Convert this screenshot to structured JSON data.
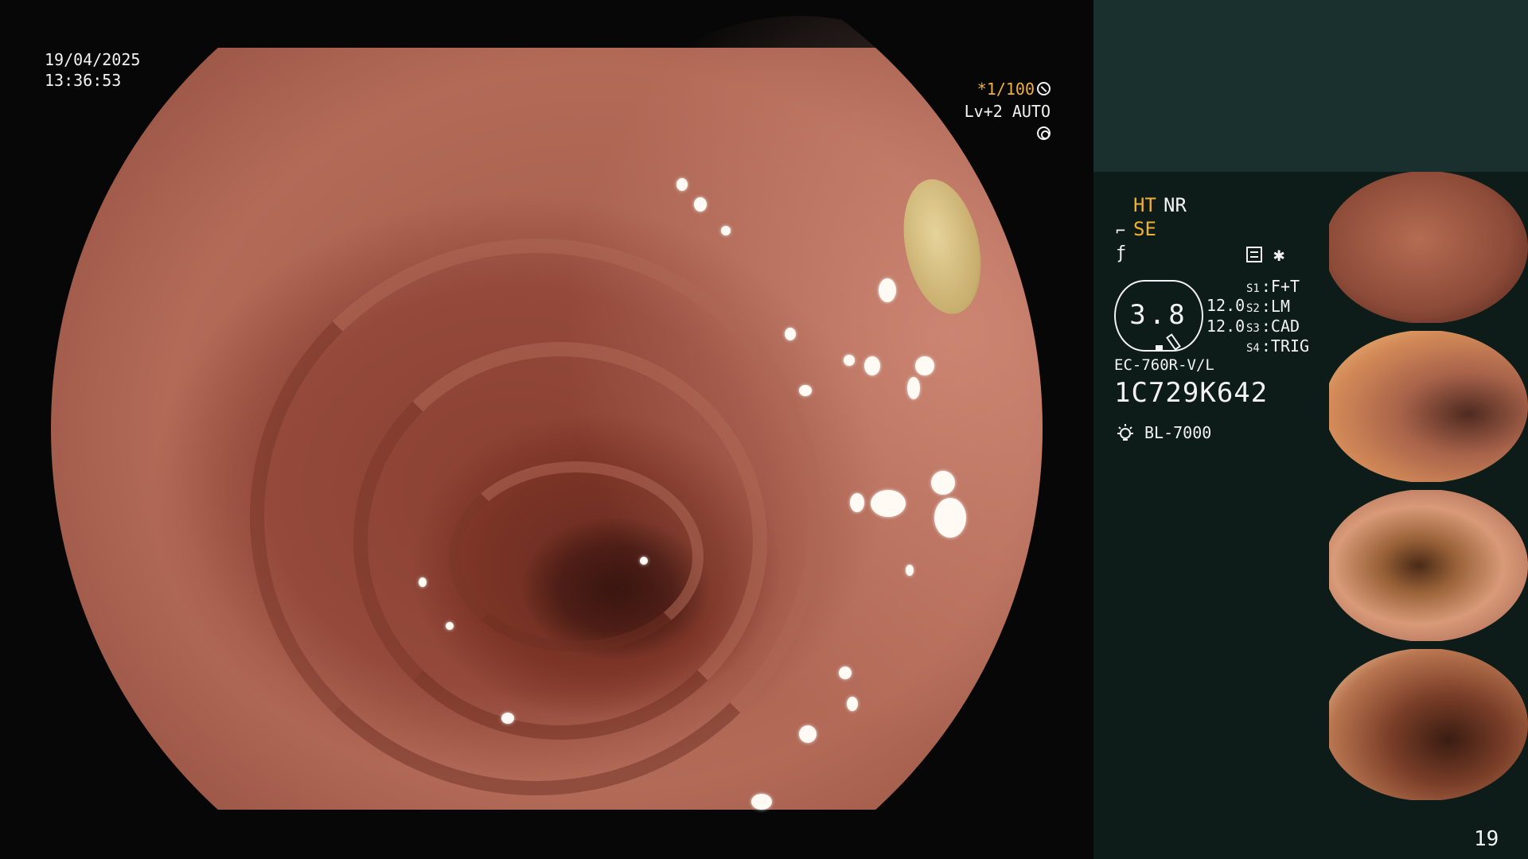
{
  "overlay": {
    "date": "19/04/2025",
    "time": "13:36:53",
    "shutter": "*1/100",
    "level": "Lv+2 AUTO"
  },
  "panel": {
    "modes": {
      "ht": "HT",
      "nr": "NR",
      "se": "SE"
    },
    "zoom_value": "3.8",
    "gauge_a": "12.0",
    "gauge_b": "12.0",
    "switches": [
      {
        "key": "S1",
        "label": "F+T"
      },
      {
        "key": "S2",
        "label": "LM"
      },
      {
        "key": "S3",
        "label": "CAD"
      },
      {
        "key": "S4",
        "label": "TRIG"
      }
    ],
    "scope_model": "EC-760R-V/L",
    "scope_serial": "1C729K642",
    "light_source": "BL-7000",
    "page_number": "19"
  },
  "icons": {
    "shutter_icon": "circle-shutter-icon",
    "level_icon": "circle-gear-icon",
    "se_icon": "structure-enhance-icon",
    "f_icon": "color-f-icon",
    "settings_icon": "settings-list-icon",
    "asterisk_icon": "asterisk-icon",
    "light_icon": "light-bulb-icon"
  },
  "colors": {
    "accent_orange": "#f0b030",
    "panel_top": "#1a302e",
    "panel_bg": "#0d1b19",
    "text": "#f2f2f2"
  }
}
